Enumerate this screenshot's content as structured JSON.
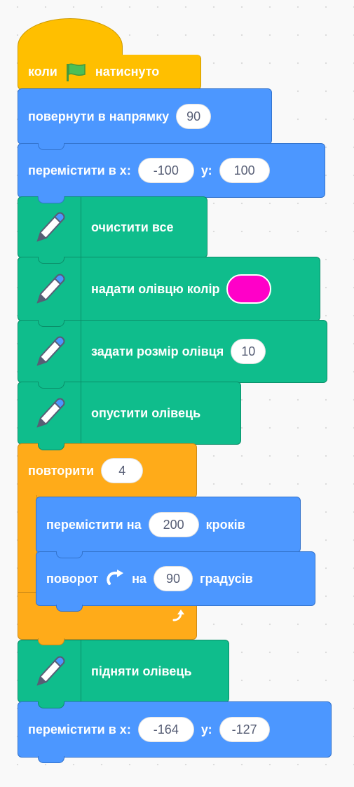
{
  "script": {
    "hat": {
      "label_before": "коли",
      "flag_icon": "green-flag-icon",
      "label_after": "натиснуто",
      "color": "#ffbf00"
    },
    "point_direction": {
      "label": "повернути в напрямку",
      "value": "90",
      "color": "#4c97ff"
    },
    "goto_xy_1": {
      "label": "перемістити в х:",
      "x": "-100",
      "y_label": "у:",
      "y": "100"
    },
    "pen_clear": {
      "label": "очистити все",
      "color": "#0fbd8c"
    },
    "pen_set_color": {
      "label": "надати олівцю колір",
      "color_value": "#ff00c8"
    },
    "pen_set_size": {
      "label": "задати розмір олівця",
      "value": "10"
    },
    "pen_down": {
      "label": "опустити олівець"
    },
    "repeat": {
      "label": "повторити",
      "value": "4",
      "color": "#ffab19",
      "loop_icon": "loop-arrow-icon"
    },
    "move_steps": {
      "label_before": "перемістити на",
      "value": "200",
      "label_after": "кроків"
    },
    "turn_right": {
      "label_before": "поворот",
      "turn_icon": "rotate-right-icon",
      "label_mid": "на",
      "value": "90",
      "label_after": "градусів"
    },
    "pen_up": {
      "label": "підняти олівець"
    },
    "goto_xy_2": {
      "label": "перемістити в х:",
      "x": "-164",
      "y_label": "у:",
      "y": "-127"
    }
  }
}
